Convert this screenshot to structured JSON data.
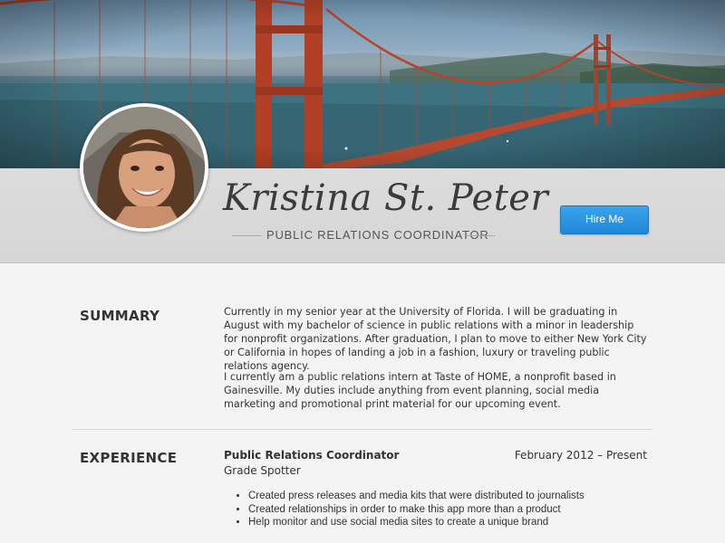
{
  "profile": {
    "name": "Kristina St. Peter",
    "role": "PUBLIC RELATIONS COORDINATOR",
    "hire_label": "Hire Me"
  },
  "summary": {
    "heading": "SUMMARY",
    "paragraph_1": "Currently in my senior year at the University of Florida. I will be graduating in August with my bachelor of science in public relations with a minor in leadership for nonprofit organizations. After graduation, I plan to move to either New York City or California in hopes of landing a job in a fashion, luxury or traveling public relations agency.",
    "paragraph_2": "I currently am a public relations intern at Taste of HOME, a nonprofit based in Gainesville. My duties include anything from event planning, social media marketing and promotional print material for our upcoming event."
  },
  "experience": {
    "heading": "EXPERIENCE",
    "jobs": [
      {
        "title": "Public Relations Coordinator",
        "company": "Grade Spotter",
        "dates": "February 2012 – Present",
        "bullets": [
          "Created press releases and media kits that were distributed to journalists",
          "Created relationships in order to make this app more than a product",
          "Help monitor and use social media sites to create a unique brand"
        ]
      }
    ]
  },
  "icons": {
    "cover": "golden-gate-bridge-photo",
    "avatar": "profile-photo"
  }
}
